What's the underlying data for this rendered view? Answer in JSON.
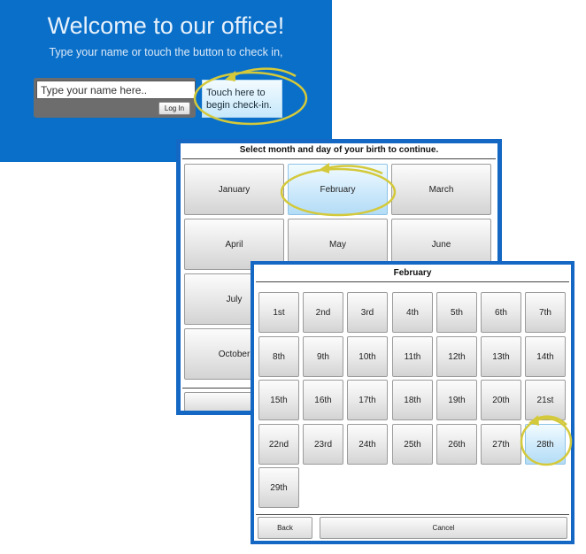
{
  "welcome": {
    "title": "Welcome to our office!",
    "subtitle": "Type your name or touch the button to check in,",
    "name_placeholder": "Type your name here..",
    "login_label": "Log In",
    "checkin_label": "Touch here to begin check-in."
  },
  "month_select": {
    "title": "Select month and day of your birth to continue.",
    "months": [
      "January",
      "February",
      "March",
      "April",
      "May",
      "June",
      "July",
      "",
      "",
      "October",
      "",
      ""
    ],
    "selected": "February"
  },
  "day_select": {
    "title": "February",
    "days": [
      "1st",
      "2nd",
      "3rd",
      "4th",
      "5th",
      "6th",
      "7th",
      "8th",
      "9th",
      "10th",
      "11th",
      "12th",
      "13th",
      "14th",
      "15th",
      "16th",
      "17th",
      "18th",
      "19th",
      "20th",
      "21st",
      "22nd",
      "23rd",
      "24th",
      "25th",
      "26th",
      "27th",
      "28th",
      "29th"
    ],
    "selected": "28th",
    "back_label": "Back",
    "cancel_label": "Cancel"
  },
  "colors": {
    "panel_blue": "#0a6fc9",
    "frame_blue": "#1467c3",
    "highlight_blue": "#cde9fb",
    "annotation_yellow": "#d4c93a"
  }
}
